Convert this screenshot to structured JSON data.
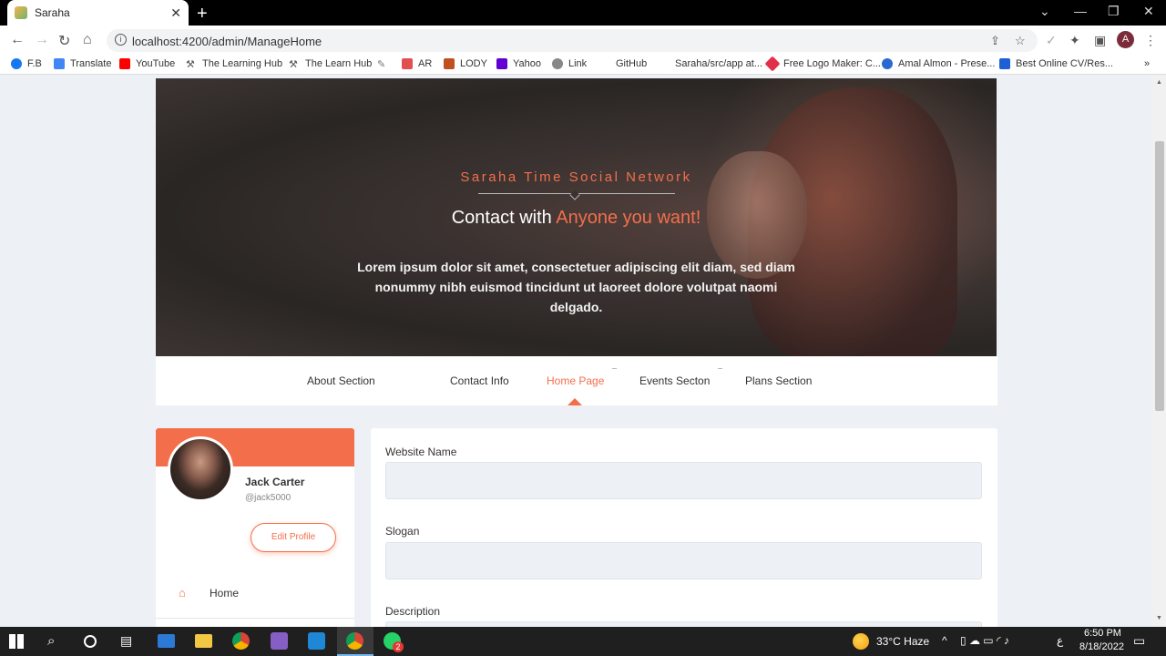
{
  "browser": {
    "tab_title": "Saraha",
    "new_tab": "+",
    "url": "localhost:4200/admin/ManageHome",
    "avatar_letter": "A",
    "bookmarks": [
      {
        "label": "F.B",
        "color": "#1877f2"
      },
      {
        "label": "Translate",
        "color": "#4285f4"
      },
      {
        "label": "YouTube",
        "color": "#ff0000"
      },
      {
        "label": "The Learning Hub",
        "color": "#555555"
      },
      {
        "label": "The Learn Hub",
        "color": "#555555"
      },
      {
        "label": "",
        "color": "#777777"
      },
      {
        "label": "AR",
        "color": "#e05050"
      },
      {
        "label": "LODY",
        "color": "#c05020"
      },
      {
        "label": "Yahoo",
        "color": "#6001d2"
      },
      {
        "label": "Link",
        "color": "#888888"
      },
      {
        "label": "GitHub",
        "color": "#ffffff"
      },
      {
        "label": "Saraha/src/app at...",
        "color": "#ffffff"
      },
      {
        "label": "Free Logo Maker: C...",
        "color": "#e0304a"
      },
      {
        "label": "Amal Almon - Prese...",
        "color": "#2a6ad0"
      },
      {
        "label": "Best Online CV/Res...",
        "color": "#1d5fd6"
      }
    ],
    "more_bookmarks": "»"
  },
  "hero": {
    "subtitle": "Saraha Time Social Network",
    "title_prefix": "Contact with ",
    "title_accent": "Anyone you want!",
    "text": "Lorem ipsum dolor sit amet, consectetuer adipiscing elit diam, sed diam nonummy nibh euismod tincidunt ut laoreet dolore volutpat naomi delgado."
  },
  "tabs": [
    {
      "label": "About Section"
    },
    {
      "label": "Contact Info"
    },
    {
      "label": "Home Page"
    },
    {
      "label": "Events Secton"
    },
    {
      "label": "Plans Section"
    }
  ],
  "profile": {
    "name": "Jack Carter",
    "handle": "@jack5000",
    "edit_label": "Edit Profile",
    "home_label": "Home"
  },
  "form": {
    "website_name_label": "Website Name",
    "website_name_value": "",
    "slogan_label": "Slogan",
    "slogan_value": "",
    "description_label": "Description"
  },
  "taskbar": {
    "weather": "33°C  Haze",
    "lang": "ع",
    "time": "6:50 PM",
    "date": "8/18/2022",
    "whatsapp_badge": "2"
  },
  "colors": {
    "accent": "#f36f4b",
    "page_bg": "#edf1f5"
  }
}
